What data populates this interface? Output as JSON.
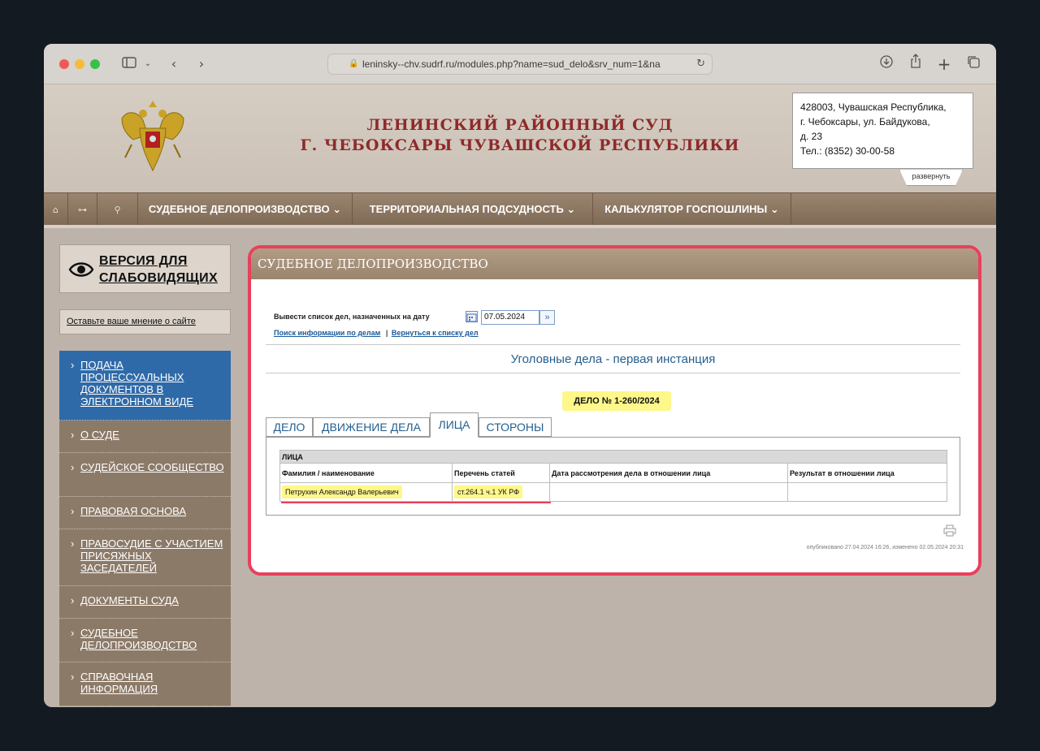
{
  "browser": {
    "url": "leninsky--chv.sudrf.ru/modules.php?name=sud_delo&srv_num=1&na",
    "sidebar_toggle_icon": "sidebar-icon",
    "nav_back_icon": "chevron-left-icon",
    "nav_forward_icon": "chevron-right-icon",
    "download_icon": "download-icon",
    "share_icon": "share-icon",
    "new_tab_icon": "plus-icon",
    "tabs_icon": "tabs-icon"
  },
  "header": {
    "title_line1": "ЛЕНИНСКИЙ РАЙОННЫЙ СУД",
    "title_line2": "Г. ЧЕБОКСАРЫ ЧУВАШСКОЙ РЕСПУБЛИКИ",
    "address_line1": "428003, Чувашская Республика,",
    "address_line2": "г. Чебоксары, ул. Байдукова,",
    "address_line3": "д. 23",
    "address_line4": "Тел.: (8352) 30-00-58",
    "expand_label": "развернуть"
  },
  "nav": {
    "items": [
      {
        "label": "СУДЕБНОЕ ДЕЛОПРОИЗВОДСТВО ⌄"
      },
      {
        "label": "ТЕРРИТОРИАЛЬНАЯ ПОДСУДНОСТЬ ⌄"
      },
      {
        "label": "КАЛЬКУЛЯТОР ГОСПОШЛИНЫ ⌄"
      }
    ]
  },
  "sidebar": {
    "low_vision_line1": "ВЕРСИЯ ДЛЯ",
    "low_vision_line2": "СЛАБОВИДЯЩИХ",
    "opinion": "Оставьте ваше мнение о сайте",
    "menu": [
      {
        "label": "ПОДАЧА ПРОЦЕССУАЛЬНЫХ ДОКУМЕНТОВ В ЭЛЕКТРОННОМ ВИДЕ"
      },
      {
        "label": "О СУДЕ"
      },
      {
        "label": "СУДЕЙСКОЕ СООБЩЕСТВО"
      },
      {
        "label": "ПРАВОВАЯ ОСНОВА"
      },
      {
        "label": "ПРАВОСУДИЕ С УЧАСТИЕМ ПРИСЯЖНЫХ ЗАСЕДАТЕЛЕЙ"
      },
      {
        "label": "ДОКУМЕНТЫ СУДА"
      },
      {
        "label": "СУДЕБНОЕ ДЕЛОПРОИЗВОДСТВО"
      },
      {
        "label": "СПРАВОЧНАЯ ИНФОРМАЦИЯ"
      }
    ]
  },
  "main": {
    "panel_title": "СУДЕБНОЕ ДЕЛОПРОИЗВОДСТВО",
    "date_label": "Вывести список дел, назначенных на дату",
    "date_value": "07.05.2024",
    "search_link": "Поиск информации по делам",
    "separator": "|",
    "back_link": "Вернуться к списку дел",
    "case_category": "Уголовные дела - первая инстанция",
    "case_number": "ДЕЛО № 1-260/2024",
    "tabs": [
      {
        "label": "ДЕЛО"
      },
      {
        "label": "ДВИЖЕНИЕ ДЕЛА"
      },
      {
        "label": "ЛИЦА"
      },
      {
        "label": "СТОРОНЫ"
      }
    ],
    "table": {
      "caption": "ЛИЦА",
      "headers": [
        "Фамилия / наименование",
        "Перечень статей",
        "Дата рассмотрения дела в отношении лица",
        "Результат в отношении лица"
      ],
      "rows": [
        [
          "Петрухин Александр Валерьевич",
          "ст.264.1 ч.1 УК РФ",
          "",
          ""
        ]
      ]
    },
    "published": "опубликовано 27.04.2024 16:26, изменено 02.05.2024 20:31"
  }
}
